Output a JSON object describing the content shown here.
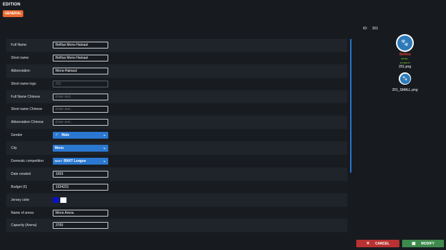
{
  "header": {
    "title": "EDITION",
    "tab": "GENERAL"
  },
  "form": {
    "full_name": {
      "label": "Full Name",
      "value": "Belfius Mons-Hainaut"
    },
    "short_name": {
      "label": "Short name",
      "value": "Belfius Mons-Hainaut"
    },
    "abbreviation": {
      "label": "Abbreviation",
      "value": "Mons-Hainaut"
    },
    "short_name_logo": {
      "label": "Short name logo",
      "value": "201"
    },
    "full_name_chinese": {
      "label": "Full Name Chinese",
      "placeholder": "Enter text..."
    },
    "short_name_chinese": {
      "label": "Short name Chinese",
      "placeholder": "Enter text..."
    },
    "abbreviation_chinese": {
      "label": "Abbreviation Chinese",
      "placeholder": "Enter text..."
    },
    "gender": {
      "label": "Gender",
      "value": "Male",
      "icon": "male-symbol-icon"
    },
    "city": {
      "label": "City",
      "value": "Mons"
    },
    "domestic_competition": {
      "label": "Domestic competition",
      "value": "BNXT League",
      "icon_text": "BNXT"
    },
    "date_created": {
      "label": "Date created",
      "value": "1659"
    },
    "budget": {
      "label": "Budget (€)",
      "value": "1934231"
    },
    "jersey_color": {
      "label": "Jersey color",
      "colors": [
        "#0a12c8",
        "#ffffff"
      ]
    },
    "arena_name": {
      "label": "Name of arena",
      "value": "Mons Arena"
    },
    "arena_capacity": {
      "label": "Capacity (Arena)",
      "value": "3700"
    }
  },
  "side": {
    "id_label": "ID:",
    "id_value": "201",
    "sponsor_text": "Belfius",
    "sponsor_sub": "MONS · HAINAUT",
    "logo_file": "201.png",
    "logo_small_file": "201_SMALL.png"
  },
  "actions": {
    "cancel": "CANCEL",
    "modify": "MODIFY"
  },
  "colors": {
    "accent": "#2b78d0",
    "tab": "#e8672c",
    "cancel": "#b83232",
    "modify": "#3e8a4c"
  }
}
